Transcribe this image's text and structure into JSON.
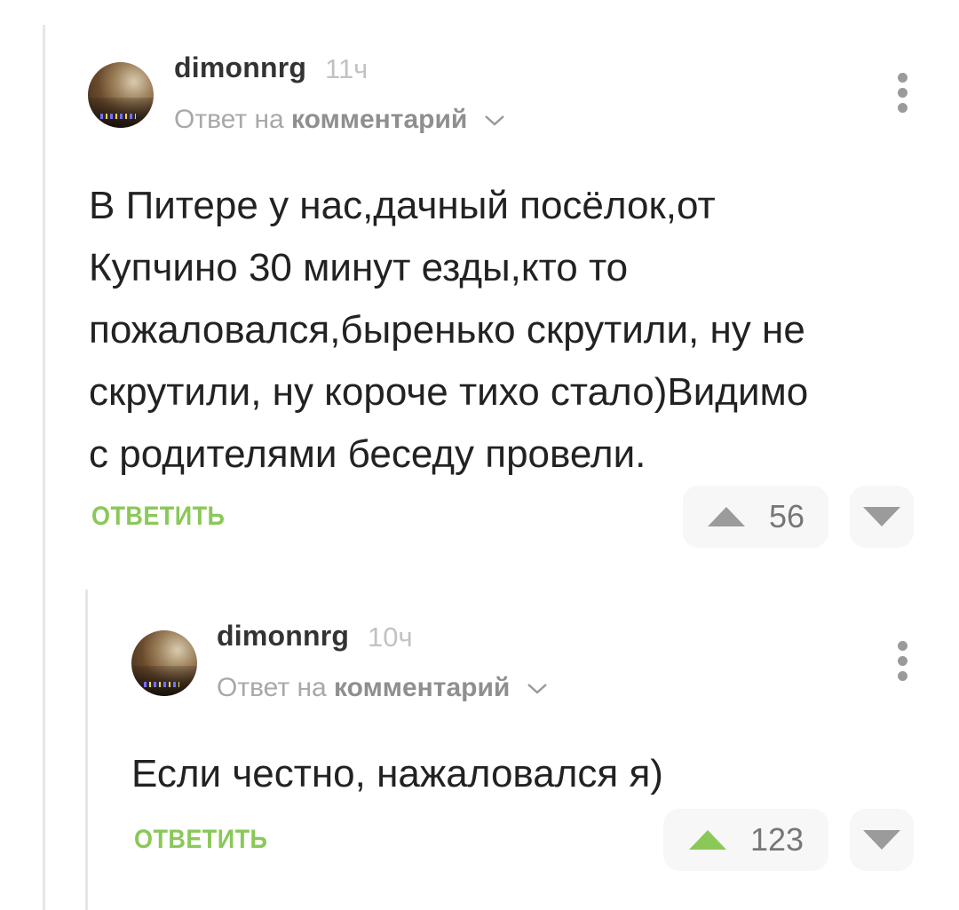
{
  "comments": [
    {
      "username": "dimonnrg",
      "time": "11ч",
      "reply_prefix": "Ответ на",
      "reply_target": "комментарий",
      "avatar_icon": "user-avatar",
      "text_lines": [
        "В Питере у нас,дачный посёлок,от",
        "Купчино 30 минут езды,кто то",
        "пожаловался,быренько скрутили, ну не",
        "скрутили, ну короче тихо стало)Видимо",
        "с родителями беседу провели."
      ],
      "reply_label": "ОТВЕТИТЬ",
      "rating": "56",
      "upvoted": false
    },
    {
      "username": "dimonnrg",
      "time": "10ч",
      "reply_prefix": "Ответ на",
      "reply_target": "комментарий",
      "avatar_icon": "user-avatar",
      "text_lines": [
        "Если честно, нажаловался я)"
      ],
      "reply_label": "ОТВЕТИТЬ",
      "rating": "123",
      "upvoted": true
    }
  ],
  "colors": {
    "accent_green": "#8ac858",
    "upvote_active": "#8ac858",
    "vote_inactive": "#9b9b9b",
    "thread_line": "#e6e6e6"
  },
  "icons": {
    "menu": "more-vertical-icon",
    "upvote": "upvote-arrow-icon",
    "downvote": "downvote-arrow-icon",
    "expand": "chevron-down-icon"
  }
}
